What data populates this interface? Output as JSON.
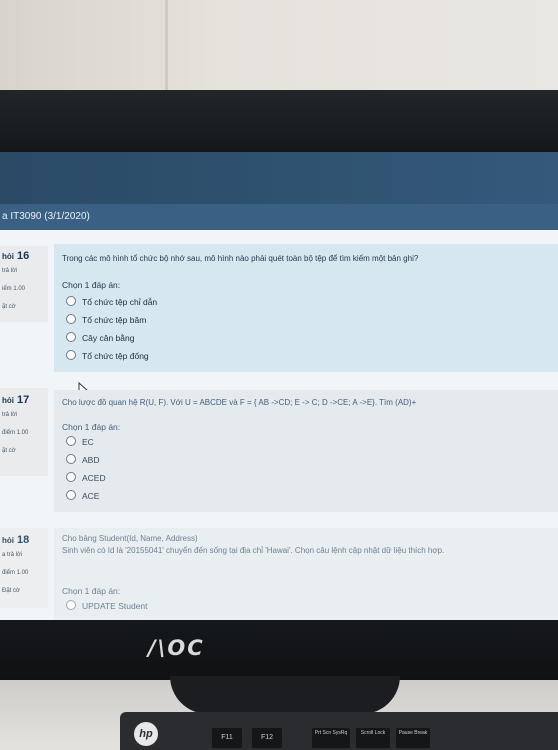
{
  "course_title": "a IT3090 (3/1/2020)",
  "questions": [
    {
      "side_label": "hỏi",
      "number": "16",
      "status": "trả lời",
      "points": "iểm 1.00",
      "flag": "ặt cờ",
      "lines": [
        "Trong các mô hình tổ chức bộ nhớ sau, mô hình nào phải quét toàn bộ tệp để tìm kiếm một bản ghi?"
      ],
      "prompt": "Chọn 1 đáp án:",
      "options": [
        "Tổ chức tệp chỉ dẫn",
        "Tổ chức tệp băm",
        "Cây cân bằng",
        "Tổ chức tệp đống"
      ]
    },
    {
      "side_label": "hỏi",
      "number": "17",
      "status": "trả lời",
      "points": "điểm 1.00",
      "flag": "ặt cờ",
      "lines": [
        "Cho lược đồ quan hệ R(U, F). Với U = ABCDE và F = { AB ->CD; E -> C; D ->CE; A ->E}. Tìm (AD)+"
      ],
      "prompt": "Chọn 1 đáp án:",
      "options": [
        "EC",
        "ABD",
        "ACED",
        "ACE"
      ]
    },
    {
      "side_label": "hỏi",
      "number": "18",
      "status": "a trả lời",
      "points": "điểm 1.00",
      "flag": "Đặt cờ",
      "lines": [
        "Cho bảng Student(Id, Name, Address)",
        "Sinh viên có Id là '20155041' chuyển đến sống tại địa chỉ 'Hawai'. Chọn câu lệnh cập nhật dữ liệu thích hợp."
      ],
      "prompt": "Chọn 1 đáp án:",
      "options": [
        "UPDATE Student"
      ]
    }
  ],
  "monitor_brand": "/\\OC",
  "laptop_brand": "hp",
  "keys": [
    "F11",
    "F12",
    "Prt Scn SysRq",
    "Scroll Lock",
    "Pause Break"
  ]
}
